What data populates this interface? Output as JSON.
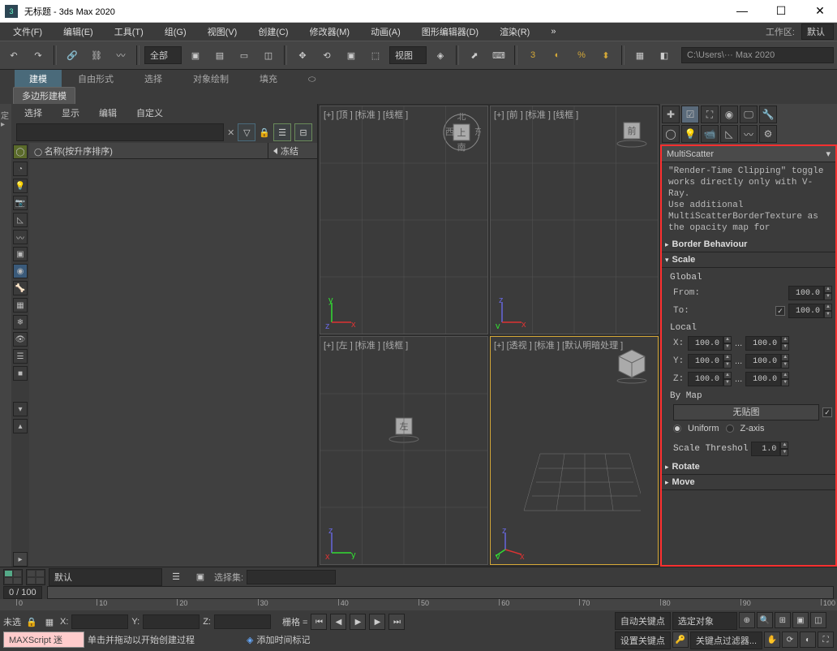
{
  "window": {
    "title": "无标题 - 3ds Max 2020"
  },
  "menubar": {
    "items": [
      "文件(F)",
      "编辑(E)",
      "工具(T)",
      "组(G)",
      "视图(V)",
      "创建(C)",
      "修改器(M)",
      "动画(A)",
      "图形编辑器(D)",
      "渲染(R)"
    ],
    "workspace_label": "工作区:",
    "workspace_value": "默认"
  },
  "toolbar": {
    "filter_select": "全部",
    "coord_select": "视图",
    "path": "C:\\Users\\··· Max 2020"
  },
  "ribbon": {
    "tabs": [
      "建模",
      "自由形式",
      "选择",
      "对象绘制",
      "填充"
    ],
    "subtab": "多边形建模"
  },
  "scene_explorer": {
    "tabs": [
      "选择",
      "显示",
      "编辑",
      "自定义"
    ],
    "col_name": "名称(按升序排序)",
    "col_frozen": "冻结"
  },
  "viewports": {
    "top": "[+] [顶 ] [标准 ] [线框 ]",
    "front": "[+] [前 ] [标准 ] [线框 ]",
    "left": "[+] [左 ] [标准 ] [线框 ]",
    "persp": "[+] [透视 ] [标准 ] [默认明暗处理 ]"
  },
  "cmd_panel": {
    "rollout_title": "MultiScatter",
    "info_text": "\"Render-Time Clipping\" toggle works directly only with V-Ray.\nUse additional MultiScatterBorderTexture as the opacity map for",
    "border_header": "Border Behaviour",
    "scale": {
      "header": "Scale",
      "global_label": "Global",
      "from_label": "From:",
      "from_val": "100.0",
      "to_label": "To:",
      "to_checked": true,
      "to_val": "100.0",
      "local_label": "Local",
      "x_label": "X:",
      "x_from": "100.0",
      "x_to": "100.0",
      "y_label": "Y:",
      "y_from": "100.0",
      "y_to": "100.0",
      "z_label": "Z:",
      "z_from": "100.0",
      "z_to": "100.0",
      "dots": "...",
      "bymap_label": "By Map",
      "map_btn": "无贴图",
      "map_checked": true,
      "uniform_label": "Uniform",
      "zaxis_label": "Z-axis",
      "threshold_label": "Scale Threshol",
      "threshold_val": "1.0"
    },
    "rotate_header": "Rotate",
    "move_header": "Move"
  },
  "status": {
    "layer": "默认",
    "selection_set_label": "选择集:",
    "time_display": "0   /  100",
    "hint": "单击并拖动以开始创建过程",
    "none_label": "未选",
    "x_label": "X:",
    "y_label": "Y:",
    "z_label": "Z:",
    "grid_label": "栅格 =",
    "add_time_tag": "添加时间标记",
    "auto_key": "自动关键点",
    "set_key": "设置关键点",
    "selected_obj": "选定对象",
    "key_filter": "关键点过滤器...",
    "maxscript": "MAXScript 迷"
  },
  "ruler_ticks": [
    0,
    10,
    20,
    30,
    40,
    50,
    60,
    70,
    80,
    90,
    100
  ]
}
